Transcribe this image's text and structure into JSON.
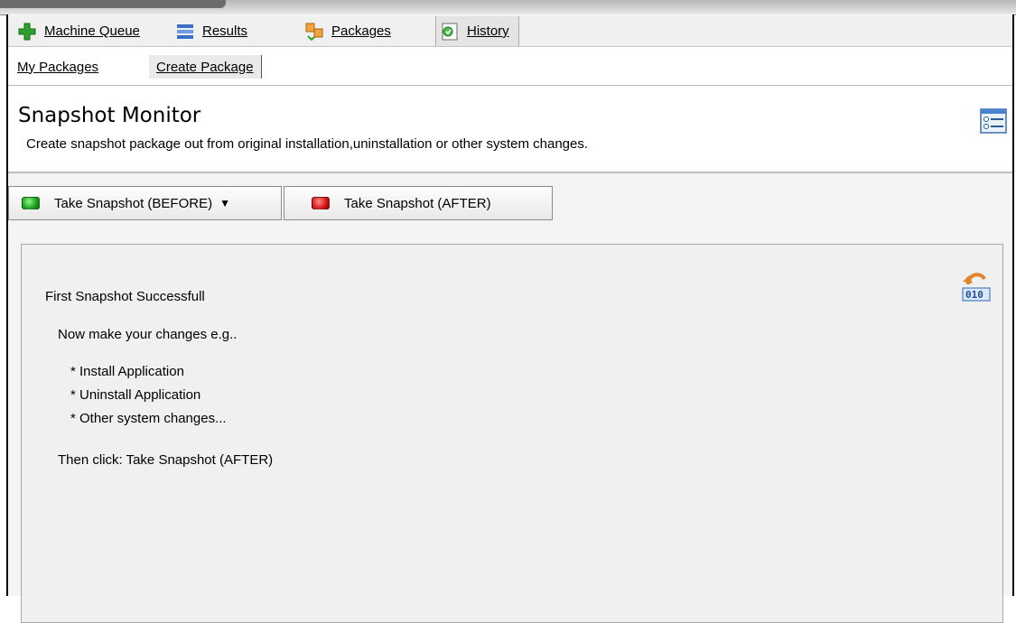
{
  "toolbar": {
    "items": [
      {
        "label": "Machine Queue",
        "icon": "add-icon"
      },
      {
        "label": "Results",
        "icon": "results-icon"
      },
      {
        "label": "Packages",
        "icon": "packages-icon"
      },
      {
        "label": "History",
        "icon": "history-icon"
      }
    ]
  },
  "subtabs": [
    "My Packages",
    "Create Package"
  ],
  "header": {
    "title": "Snapshot Monitor",
    "description": "Create snapshot package out from original installation,uninstallation or other system changes.",
    "icon": "properties-icon"
  },
  "buttons": {
    "before": {
      "label": "Take Snapshot (BEFORE)",
      "led_color": "#1ea31e",
      "icon": "dropdown-arrow-icon"
    },
    "after": {
      "label": "Take Snapshot (AFTER)",
      "led_color": "#d61818"
    }
  },
  "panel": {
    "status": "First Snapshot Successfull",
    "instruction": "Now make your changes e.g..",
    "items": [
      "* Install Application",
      "* Uninstall Application",
      "* Other system changes..."
    ],
    "final": "Then click: Take Snapshot (AFTER)",
    "icon": "undo-binary-icon"
  }
}
